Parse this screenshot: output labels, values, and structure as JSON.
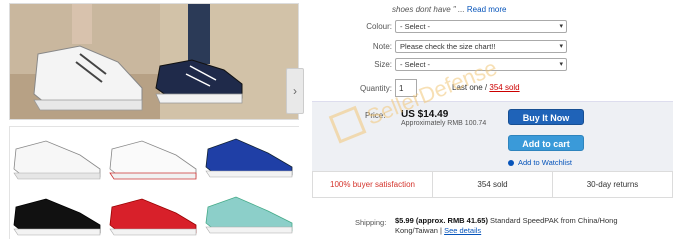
{
  "top_note": {
    "text": "shoes dont have \" ...",
    "link": "Read more"
  },
  "options": {
    "colour": {
      "label": "Colour:",
      "value": "- Select -"
    },
    "note": {
      "label": "Note:",
      "value": "Please check the size chart!!"
    },
    "size": {
      "label": "Size:",
      "value": "- Select -"
    }
  },
  "quantity": {
    "label": "Quantity:",
    "value": "1",
    "remaining": "Last one /",
    "sold_link": "354 sold"
  },
  "price": {
    "label": "Price:",
    "value": "US $14.49",
    "approx": "Approximately RMB 100.74"
  },
  "buttons": {
    "buy_now": "Buy It Now",
    "add_to_cart": "Add to cart",
    "watchlist": "Add to Watchlist"
  },
  "stats": [
    "100% buyer satisfaction",
    "354 sold",
    "30-day returns"
  ],
  "shipping": {
    "label": "Shipping:",
    "cost": "$5.99 (approx. RMB 41.65)",
    "description": "Standard SpeedPAK from China/Hong Kong/Taiwan |",
    "details_link": "See details"
  },
  "watermark_text": "SellerDefense",
  "colors": {
    "accent_blue": "#1f63b8",
    "cart_blue": "#3a9ad9",
    "link": "#0654ba",
    "highlight_red": "#d4342c",
    "watermark": "#f2c77a"
  }
}
